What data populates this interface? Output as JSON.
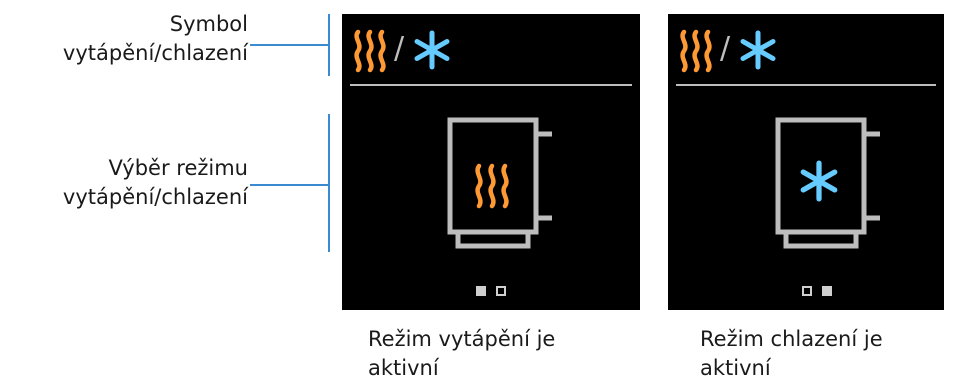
{
  "colors": {
    "heat": "#ff9933",
    "cool": "#66ccff",
    "frame": "#bdbdbd",
    "accent_line": "#3a8bd0"
  },
  "labels": {
    "symbol": "Symbol\nvytápění/chlazení",
    "mode_select": "Výběr režimu\nvytápění/chlazení"
  },
  "screens": [
    {
      "header_icons": [
        "heat-wave-icon",
        "snowflake-icon"
      ],
      "header_slash": "/",
      "center_icon": "heat-wave-icon",
      "page_indicator": {
        "count": 2,
        "active": 1
      }
    },
    {
      "header_icons": [
        "heat-wave-icon",
        "snowflake-icon"
      ],
      "header_slash": "/",
      "center_icon": "snowflake-icon",
      "page_indicator": {
        "count": 2,
        "active": 2
      }
    }
  ],
  "captions": {
    "heating": "Režim vytápění je\naktivní",
    "cooling": "Režim chlazení je\naktivní"
  }
}
